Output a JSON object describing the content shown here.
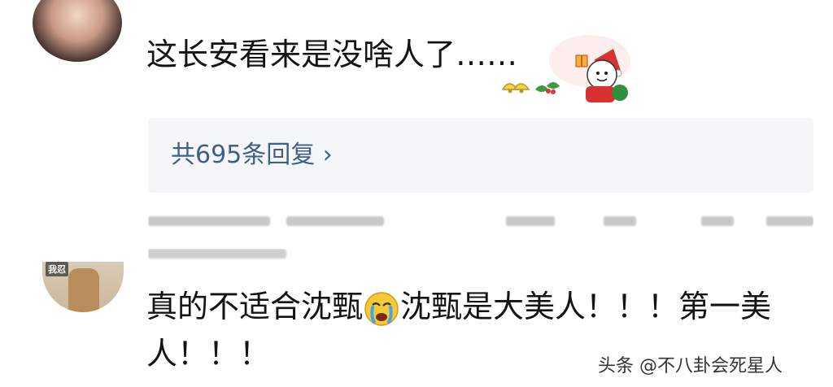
{
  "comments": [
    {
      "text": "这长安看来是没啥人了……",
      "stickers": [
        "bell-sticker",
        "holly-sticker",
        "santa-sticker"
      ]
    },
    {
      "avatar_tag": "我忍",
      "text_before_emoji": "真的不适合沈甄",
      "emoji": "crying-face",
      "text_after_emoji": "沈甄是大美人！！！第一美人！！！"
    }
  ],
  "reply_summary": "共695条回复 ›",
  "watermark": "头条 @不八卦会死星人",
  "colors": {
    "reply_link": "#3f5f86",
    "reply_bg": "#f5f6f8"
  }
}
